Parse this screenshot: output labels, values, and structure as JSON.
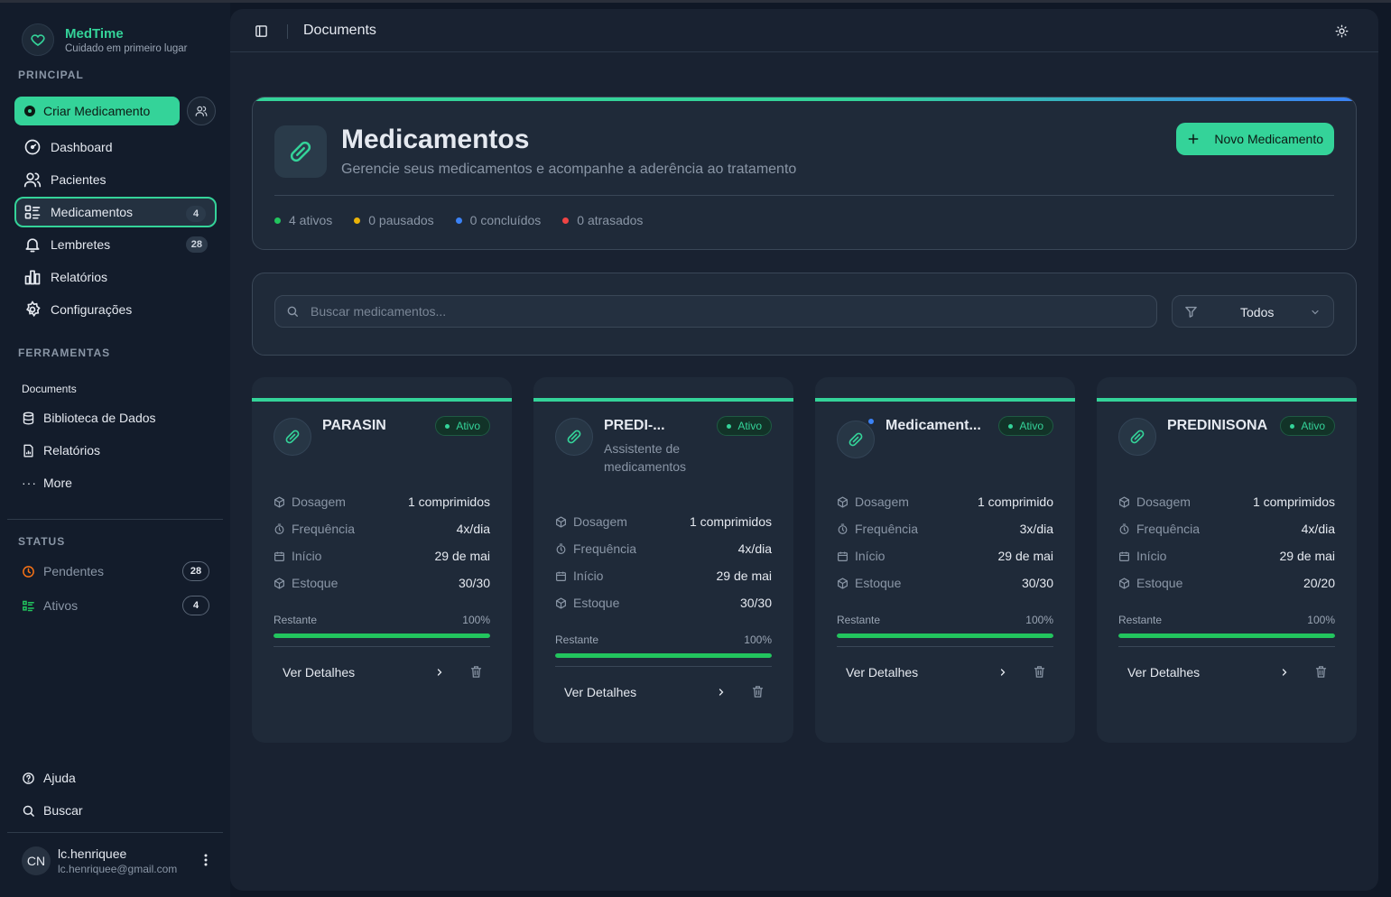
{
  "brand": {
    "name": "MedTime",
    "tagline": "Cuidado em primeiro lugar"
  },
  "sidebar": {
    "section_principal": "PRINCIPAL",
    "create_button": "Criar Medicamento",
    "nav": [
      {
        "label": "Dashboard",
        "icon": "gauge-icon"
      },
      {
        "label": "Pacientes",
        "icon": "users-icon"
      },
      {
        "label": "Medicamentos",
        "icon": "list-icon",
        "badge": "4",
        "active": true
      },
      {
        "label": "Lembretes",
        "icon": "bell-icon",
        "badge": "28"
      },
      {
        "label": "Relatórios",
        "icon": "bar-chart-icon"
      },
      {
        "label": "Configurações",
        "icon": "gear-icon"
      }
    ],
    "section_tools": "FERRAMENTAS",
    "tools_header": "Documents",
    "tools": [
      {
        "label": "Biblioteca de Dados",
        "icon": "database-icon"
      },
      {
        "label": "Relatórios",
        "icon": "file-chart-icon"
      },
      {
        "label": "More",
        "icon": "dots-icon"
      }
    ],
    "section_status": "STATUS",
    "status": [
      {
        "label": "Pendentes",
        "count": "28",
        "icon": "clock-icon",
        "color": "#f97316"
      },
      {
        "label": "Ativos",
        "count": "4",
        "icon": "list-check-icon",
        "color": "#22c55e"
      }
    ],
    "footer": [
      {
        "label": "Ajuda",
        "icon": "help-icon"
      },
      {
        "label": "Buscar",
        "icon": "search-icon"
      }
    ],
    "user": {
      "initials": "CN",
      "name": "lc.henriquee",
      "email": "lc.henriquee@gmail.com"
    }
  },
  "topbar": {
    "title": "Documents"
  },
  "hero": {
    "title": "Medicamentos",
    "subtitle": "Gerencie seus medicamentos e acompanhe a aderência ao tratamento",
    "button": "Novo Medicamento",
    "stats": [
      {
        "label": "4 ativos",
        "color": "#22c55e"
      },
      {
        "label": "0 pausados",
        "color": "#eab308"
      },
      {
        "label": "0 concluídos",
        "color": "#3b82f6"
      },
      {
        "label": "0 atrasados",
        "color": "#ef4444"
      }
    ]
  },
  "search": {
    "placeholder": "Buscar medicamentos...",
    "filter_value": "Todos"
  },
  "labels": {
    "dosage": "Dosagem",
    "frequency": "Frequência",
    "start": "Início",
    "stock": "Estoque",
    "remaining": "Restante",
    "details": "Ver Detalhes"
  },
  "cards": [
    {
      "name": "PARASIN",
      "desc": "",
      "status": "Ativo",
      "dosage": "1 comprimidos",
      "frequency": "4x/dia",
      "start": "29 de mai",
      "stock": "30/30",
      "remaining_pct": "100%",
      "remaining": 1.0,
      "notify": false
    },
    {
      "name": "PREDI-...",
      "desc": "Assistente de medicamentos",
      "status": "Ativo",
      "dosage": "1 comprimidos",
      "frequency": "4x/dia",
      "start": "29 de mai",
      "stock": "30/30",
      "remaining_pct": "100%",
      "remaining": 1.0,
      "notify": false
    },
    {
      "name": "Medicament...",
      "desc": "",
      "status": "Ativo",
      "dosage": "1 comprimido",
      "frequency": "3x/dia",
      "start": "29 de mai",
      "stock": "30/30",
      "remaining_pct": "100%",
      "remaining": 1.0,
      "notify": true
    },
    {
      "name": "PREDINISONA",
      "desc": "",
      "status": "Ativo",
      "dosage": "1 comprimidos",
      "frequency": "4x/dia",
      "start": "29 de mai",
      "stock": "20/20",
      "remaining_pct": "100%",
      "remaining": 1.0,
      "notify": false
    }
  ]
}
